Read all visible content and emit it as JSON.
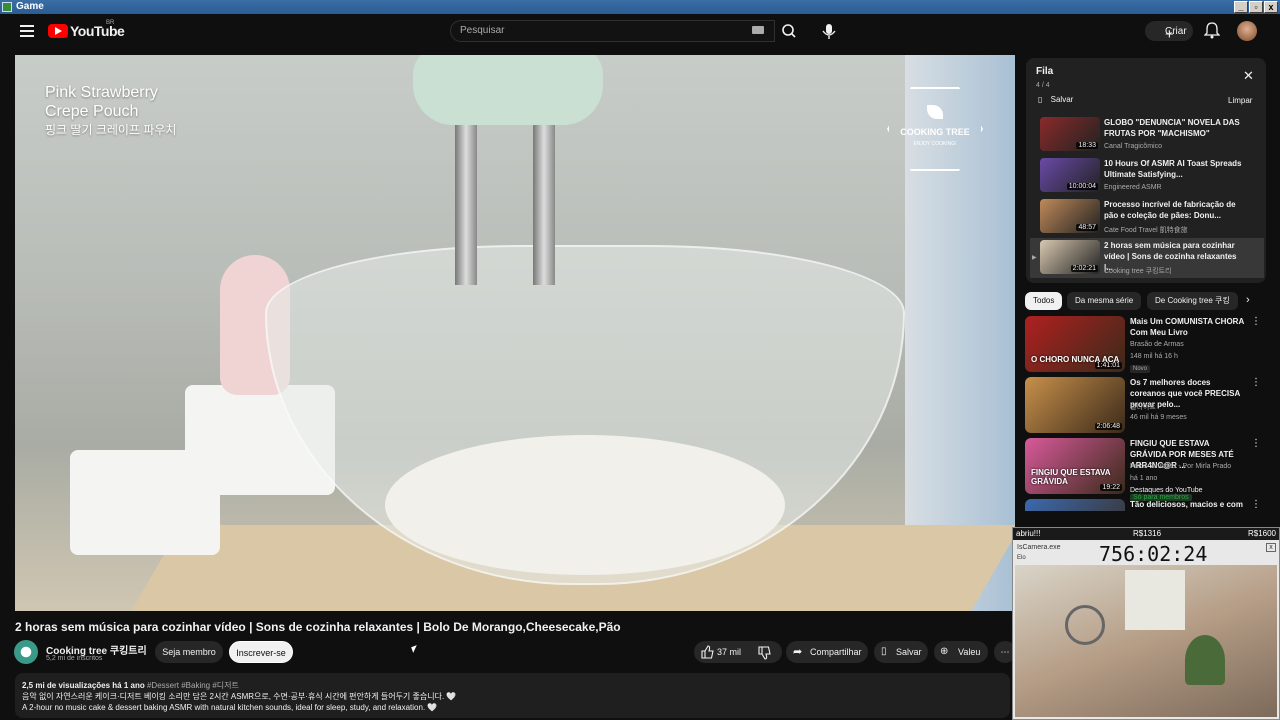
{
  "window": {
    "title": "Game",
    "buttons": [
      "_",
      "▫",
      "x"
    ]
  },
  "header": {
    "logo_text": "YouTube",
    "logo_region": "BR",
    "search_placeholder": "Pesquisar",
    "create_label": "Criar"
  },
  "video": {
    "overlay_title_line1": "Pink Strawberry",
    "overlay_title_line2": "Crepe Pouch",
    "overlay_title_kr": "핑크 딸기 크레이프 파우치",
    "badge_main": "COOKING TREE",
    "badge_sub": "ENJOY COOKING!"
  },
  "details": {
    "title": "2 horas sem música para cozinhar vídeo | Sons de cozinha relaxantes | Bolo De Morango,Cheesecake,Pão",
    "channel_name": "Cooking tree 쿠킹트리",
    "subscribers": "5,2 mi de inscritos",
    "member_label": "Seja membro",
    "subscribe_label": "Inscrever-se",
    "likes": "37 mil",
    "share_label": "Compartilhar",
    "save_label": "Salvar",
    "thanks_label": "Valeu",
    "views_date": "2,5 mi de visualizações  há 1 ano",
    "tags": "#Dessert #Baking #디저트",
    "desc_line1": "음악 없이 자연스러운 케이크·디저트 베이킹 소리만 담은 2시간 ASMR으로, 수면·공부·휴식 시간에 편안하게 들어두기 좋습니다. 🤍",
    "desc_line2": "A 2-hour no music cake & dessert baking ASMR with natural kitchen sounds, ideal for sleep, study, and relaxation. 🤍"
  },
  "queue": {
    "title": "Fila",
    "count": "4 / 4",
    "save_label": "Salvar",
    "clear_label": "Limpar",
    "items": [
      {
        "title": "GLOBO \"DENUNCIA\" NOVELA DAS FRUTAS POR \"MACHISMO\"",
        "channel": "Canal Tragicômico",
        "duration": "18:33",
        "color": "#8a2a2a"
      },
      {
        "title": "10 Hours Of ASMR AI Toast Spreads Ultimate Satisfying...",
        "channel": "Engineered ASMR",
        "duration": "10:00:04",
        "color": "#6a4aa8"
      },
      {
        "title": "Processo incrível de fabricação de pão e coleção de pães: Donu...",
        "channel": "Cate Food Travel 凱特食旅",
        "duration": "48:57",
        "color": "#c08a5a"
      },
      {
        "title": "2 horas sem música para cozinhar vídeo | Sons de cozinha relaxantes |...",
        "channel": "Cooking tree 쿠킹트리",
        "duration": "2:02:21",
        "color": "#d8c8b0"
      }
    ]
  },
  "chips": [
    "Todos",
    "Da mesma série",
    "De Cooking tree 쿠킹"
  ],
  "recommendations": [
    {
      "title": "Mais Um COMUNISTA CHORA Com Meu Livro",
      "channel": "Brasão de Armas",
      "meta": "148 mil  há 16 h",
      "badge": "Novo",
      "duration": "1:41:01",
      "thumb_text": "O CHORO NUNCA ACA",
      "color": "#b02020"
    },
    {
      "title": "Os 7 melhores doces coreanos que você PRECISA provar pelo...",
      "channel": "빌라이트",
      "meta": "46 mil  há 9 meses",
      "badge": "",
      "duration": "2:06:48",
      "thumb_text": "",
      "color": "#c8904a"
    },
    {
      "title": "FINGIU QUE ESTAVA GRÁVIDA POR MESES ATÉ ARR4NC@R ...",
      "channel": "Fatos Sinistros - Por Mirla Prado",
      "meta": "há 1 ano",
      "badge": "Destaques do YouTube",
      "badge2": "Só para membros",
      "duration": "19:22",
      "thumb_text": "FINGIU QUE ESTAVA GRÁVIDA",
      "color": "#d85a9a"
    },
    {
      "title": "Tão deliciosos, macios e com",
      "channel": "",
      "meta": "",
      "badge": "",
      "duration": "",
      "thumb_text": "",
      "color": "#3a6ab0"
    }
  ],
  "overlay": {
    "bar_left": "abriu!!!",
    "bar_mid": "R$1316",
    "bar_right": "R$1600",
    "app_name": "IsCamera.exe",
    "app_sub": "Elo",
    "timer": "756:02:24"
  }
}
